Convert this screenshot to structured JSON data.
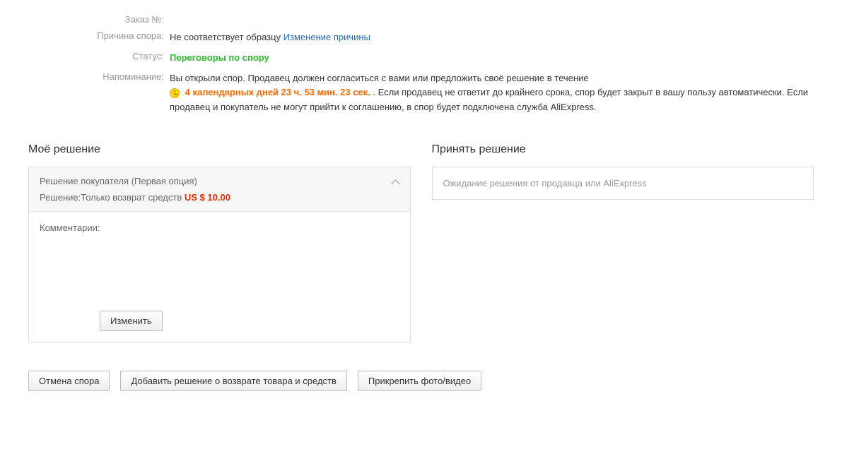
{
  "info": {
    "order_label": "Заказ №:",
    "order_value": "",
    "reason_label": "Причина спора:",
    "reason_value": "Не соответствует образцу",
    "reason_change_link": "Изменение причины",
    "status_label": "Статус:",
    "status_value": "Переговоры по спору",
    "reminder_label": "Напоминание:",
    "reminder_text1": "Вы открыли спор. Продавец должен согласиться с вами или предложить своё решение в течение",
    "countdown": "4 календарных дней 23 ч. 53 мин. 23 сек.",
    "reminder_text2": " . Если продавец не ответит до крайнего срока, спор будет закрыт в вашу пользу автоматически. Если продавец и покупатель не могут прийти к соглашению, в спор будет подключена служба AliExpress."
  },
  "my_solution": {
    "title": "Моё решение",
    "option_title": "Решение покупателя (Первая опция)",
    "decision_label": "Решение:",
    "decision_value": "Только возврат средств",
    "amount": "US $ 10.00",
    "comments_label": "Комментарии:",
    "edit_button": "Изменить"
  },
  "accept_solution": {
    "title": "Принять решение",
    "waiting_text": "Ожидание решения от продавца или AliExpress"
  },
  "actions": {
    "cancel": "Отмена спора",
    "add_solution": "Добавить решение о возврате товара и средств",
    "attach": "Прикрепить фото/видео"
  }
}
